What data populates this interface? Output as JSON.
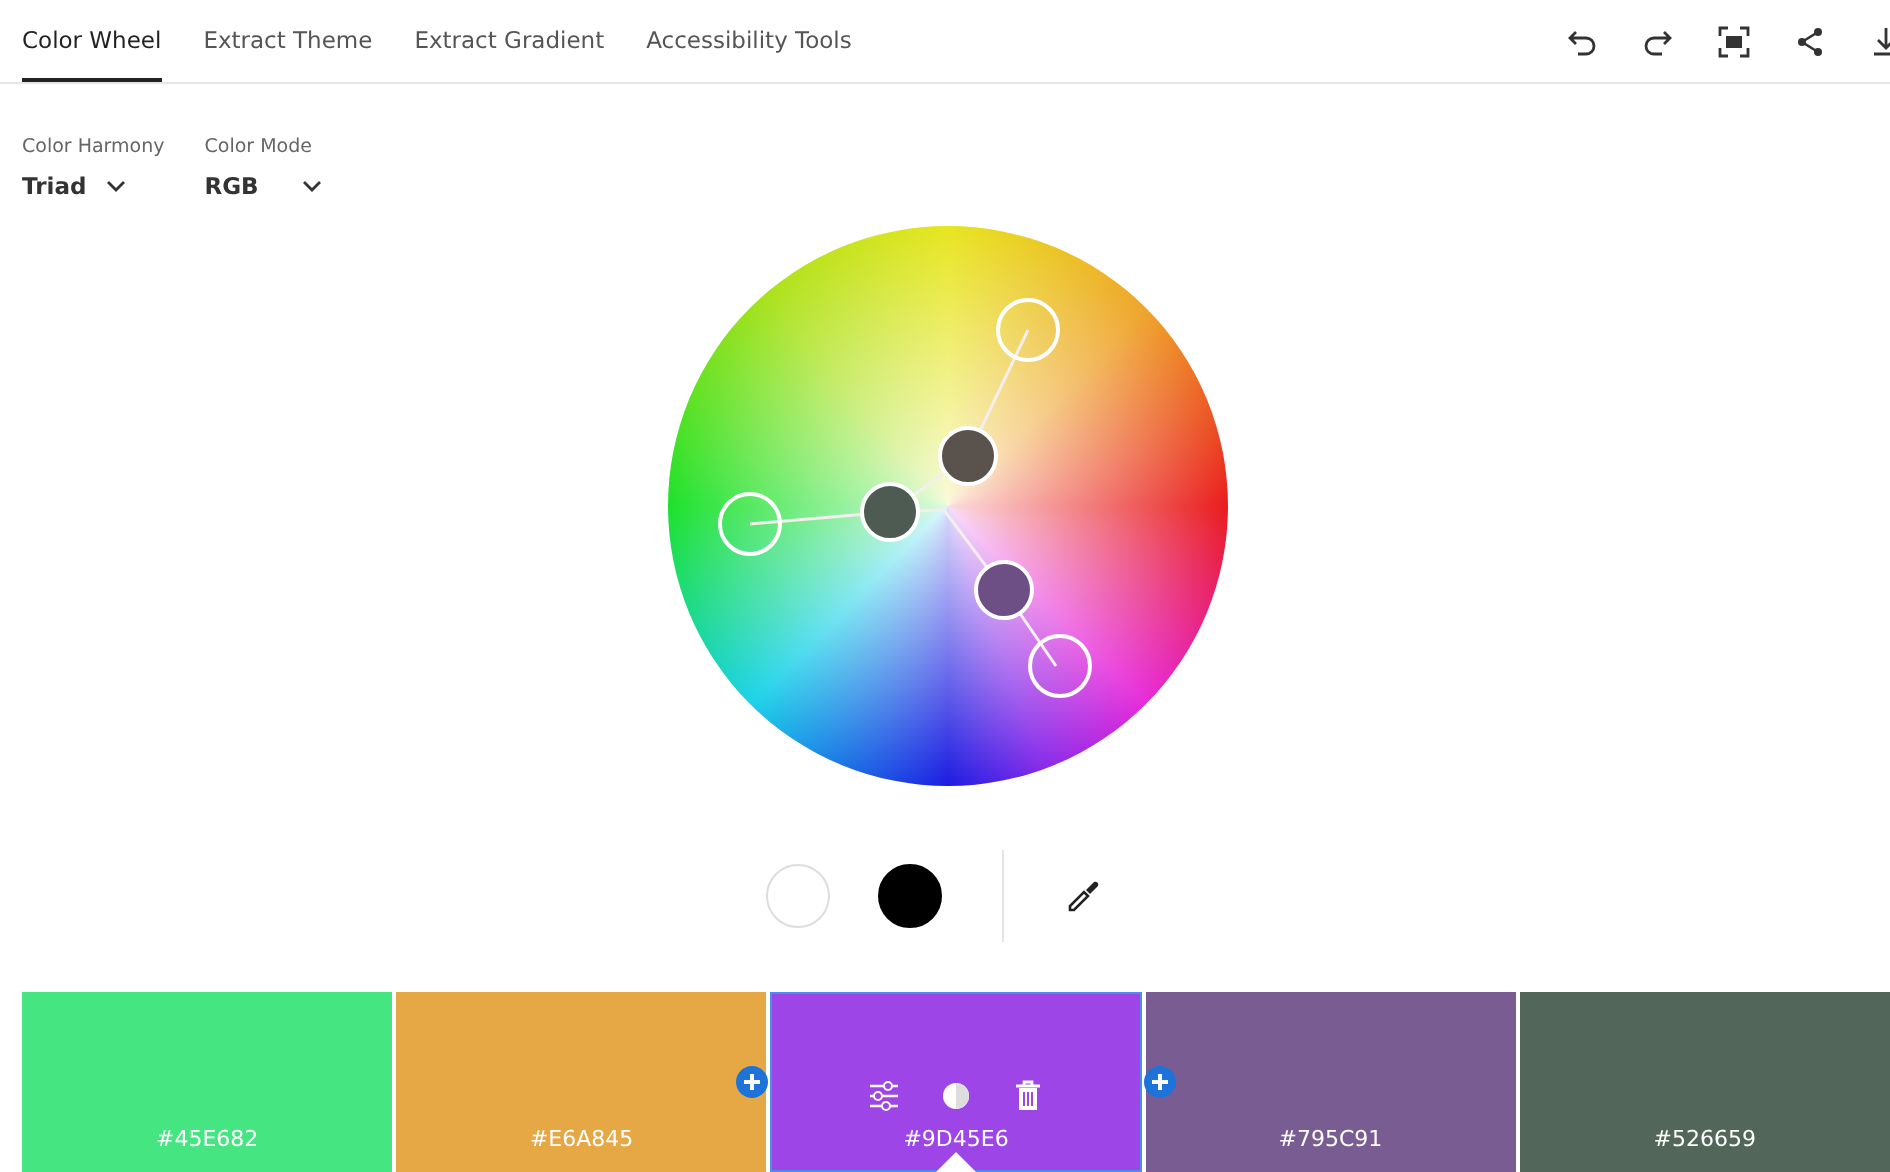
{
  "tabs": [
    {
      "label": "Color Wheel",
      "selected": true
    },
    {
      "label": "Extract Theme",
      "selected": false
    },
    {
      "label": "Extract Gradient",
      "selected": false
    },
    {
      "label": "Accessibility Tools",
      "selected": false
    }
  ],
  "toolbar": [
    {
      "kind": "undo"
    },
    {
      "kind": "redo"
    },
    {
      "kind": "fit"
    },
    {
      "kind": "share"
    },
    {
      "kind": "download"
    }
  ],
  "controls": [
    {
      "label": "Color Harmony",
      "value": "Triad"
    },
    {
      "label": "Color Mode",
      "value": "RGB"
    }
  ],
  "wheel_tools": [
    {
      "kind": "light"
    },
    {
      "kind": "dark"
    },
    {
      "kind": "eyedropper"
    }
  ],
  "swatches": [
    {
      "hex": "#45E682",
      "color": "#45e682",
      "selected": false
    },
    {
      "hex": "#E6A845",
      "color": "#e6a845",
      "selected": false
    },
    {
      "hex": "#9D45E6",
      "color": "#9d45e6",
      "selected": true
    },
    {
      "hex": "#795C91",
      "color": "#795c91",
      "selected": false
    },
    {
      "hex": "#526659",
      "color": "#526659",
      "selected": false
    }
  ]
}
